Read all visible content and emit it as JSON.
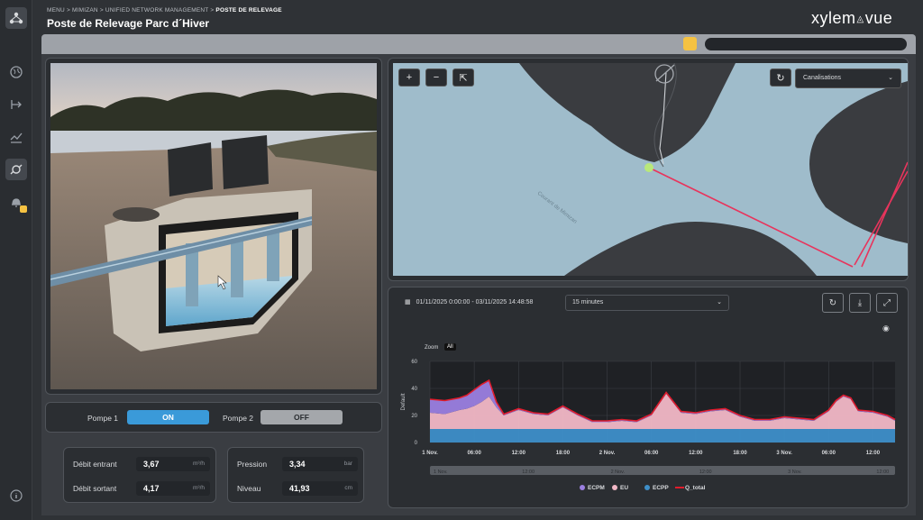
{
  "breadcrumb": {
    "menu": "MENU",
    "site": "MIMIZAN",
    "network": "UNIFIED NETWORK MANAGEMENT",
    "current": "POSTE DE RELEVAGE",
    "sep": ">"
  },
  "page_title": "Poste de Relevage Parc d´Hiver",
  "logo": {
    "left": "xylem",
    "right": "vue"
  },
  "nav_icons": [
    "network-icon",
    "globe-icon",
    "flow-icon",
    "chart-icon",
    "pump-icon",
    "bell-icon",
    "info-icon"
  ],
  "status": {
    "color": "#f5c242"
  },
  "map": {
    "zoom_in": "+",
    "zoom_out": "−",
    "fit": "⇱",
    "refresh": "↻",
    "layer": "Canalisations",
    "label_canal": "Courant de Mimizan",
    "water_color": "#9fbccb",
    "land_color": "#3a3c40",
    "pipe_color": "#e8345c"
  },
  "pumps": {
    "pump1": {
      "label": "Pompe 1",
      "state": "ON"
    },
    "pump2": {
      "label": "Pompe 2",
      "state": "OFF"
    }
  },
  "flows": {
    "in": {
      "label": "Débit entrant",
      "value": "3,67",
      "unit": "m³/h"
    },
    "out": {
      "label": "Débit sortant",
      "value": "4,17",
      "unit": "m³/h"
    }
  },
  "levels": {
    "pressure": {
      "label": "Pression",
      "value": "3,34",
      "unit": "bar"
    },
    "level": {
      "label": "Niveau",
      "value": "41,93",
      "unit": "cm"
    }
  },
  "chart_controls": {
    "date_range": "01/11/2025 0:00:00 - 03/11/2025 14:48:58",
    "interval": "15 minutes",
    "zoom_label": "Zoom",
    "zoom_all": "All"
  },
  "chart_data": {
    "type": "area",
    "ylabel": "Default",
    "ylim": [
      0,
      60
    ],
    "yticks": [
      0,
      20,
      40,
      60
    ],
    "xticks": [
      "1 Nov.",
      "06:00",
      "12:00",
      "18:00",
      "2 Nov.",
      "06:00",
      "12:00",
      "18:00",
      "3 Nov.",
      "06:00",
      "12:00"
    ],
    "navigator_ticks": [
      "1 Nov.",
      "12:00",
      "2 Nov.",
      "12:00",
      "3 Nov.",
      "12:00"
    ],
    "x_hours": [
      0,
      2,
      4,
      5,
      6,
      7,
      8,
      9,
      10,
      12,
      14,
      16,
      18,
      20,
      22,
      24,
      26,
      28,
      30,
      31,
      32,
      33,
      34,
      36,
      38,
      40,
      42,
      44,
      46,
      48,
      50,
      52,
      54,
      55,
      56,
      57,
      58,
      60,
      62,
      63
    ],
    "series": [
      {
        "name": "ECPM",
        "color": "#9b7fe0",
        "values": [
          10,
          10,
          9,
          10,
          12,
          13,
          12,
          4,
          1,
          1,
          1,
          1,
          1,
          1,
          1,
          1,
          1,
          1,
          1,
          1,
          1,
          1,
          1,
          1,
          1,
          1,
          1,
          1,
          1,
          1,
          1,
          1,
          1,
          1,
          1,
          1,
          1,
          1,
          1,
          1
        ]
      },
      {
        "name": "EU",
        "color": "#f2b8c6",
        "values": [
          12,
          11,
          14,
          15,
          17,
          20,
          24,
          16,
          10,
          14,
          11,
          10,
          16,
          10,
          5,
          5,
          6,
          5,
          10,
          18,
          26,
          19,
          12,
          11,
          13,
          14,
          9,
          6,
          6,
          8,
          7,
          6,
          13,
          20,
          24,
          22,
          13,
          12,
          9,
          6
        ]
      },
      {
        "name": "ECPP",
        "color": "#3e8fc9",
        "values": [
          10,
          10,
          10,
          10,
          10,
          10,
          10,
          10,
          10,
          10,
          10,
          10,
          10,
          10,
          10,
          10,
          10,
          10,
          10,
          10,
          10,
          10,
          10,
          10,
          10,
          10,
          10,
          10,
          10,
          10,
          10,
          10,
          10,
          10,
          10,
          10,
          10,
          10,
          10,
          10
        ]
      },
      {
        "name": "Q_total",
        "color": "#e01c2c",
        "values": [
          32,
          31,
          33,
          35,
          39,
          43,
          46,
          30,
          21,
          25,
          22,
          21,
          27,
          21,
          16,
          16,
          17,
          16,
          21,
          29,
          37,
          30,
          23,
          22,
          24,
          25,
          20,
          17,
          17,
          19,
          18,
          17,
          24,
          31,
          35,
          33,
          24,
          23,
          20,
          17
        ]
      }
    ],
    "x_range_hours": [
      0,
      63
    ]
  }
}
